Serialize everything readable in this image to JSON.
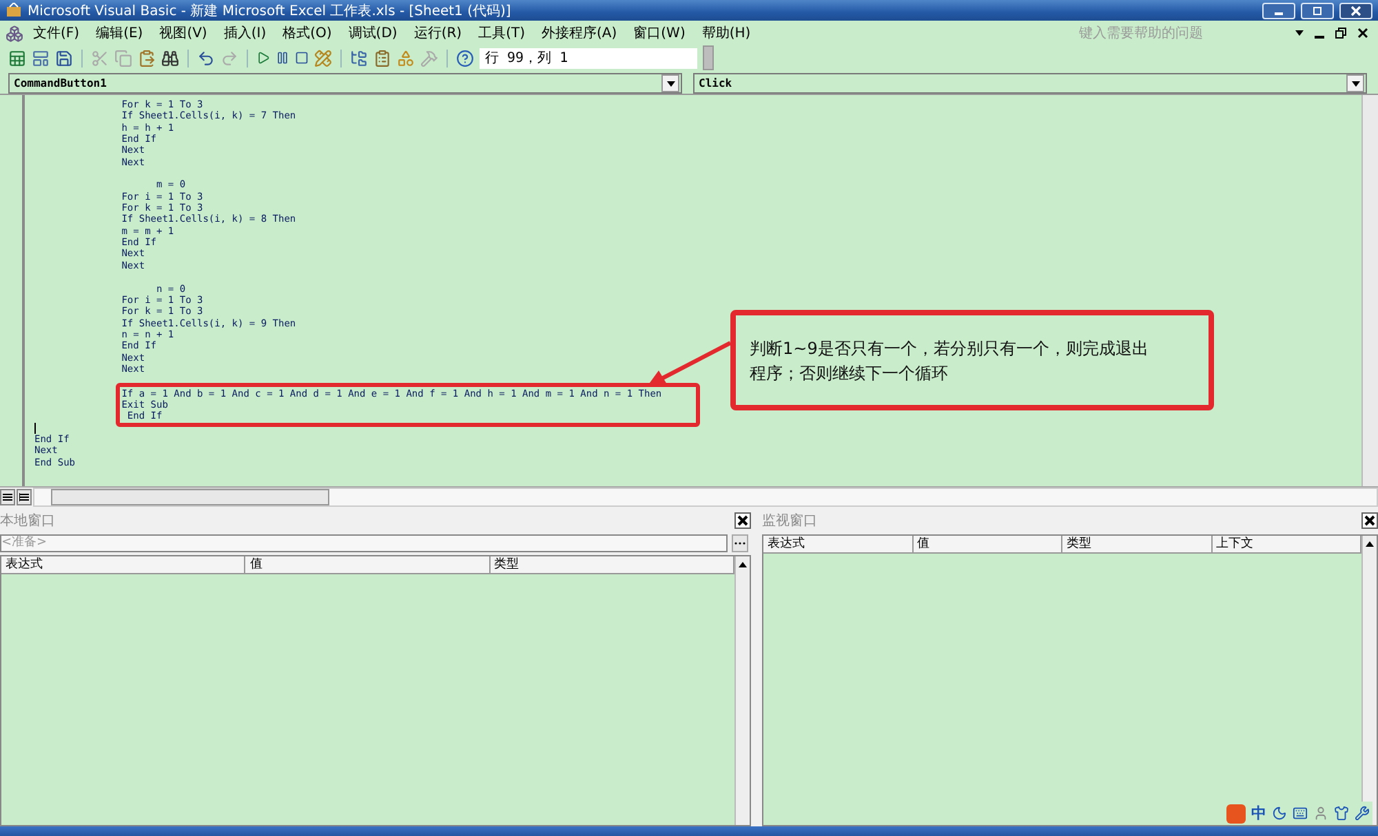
{
  "window": {
    "title": "Microsoft Visual Basic - 新建 Microsoft Excel 工作表.xls - [Sheet1 (代码)]"
  },
  "menu": [
    "文件(F)",
    "编辑(E)",
    "视图(V)",
    "插入(I)",
    "格式(O)",
    "调试(D)",
    "运行(R)",
    "工具(T)",
    "外接程序(A)",
    "窗口(W)",
    "帮助(H)"
  ],
  "help_search": {
    "placeholder": "键入需要帮助的问题"
  },
  "toolbar": {
    "position": "行 99，列 1"
  },
  "code_window": {
    "object": "CommandButton1",
    "procedure": "Click",
    "lines": [
      {
        "kind": "code",
        "text": "               For k = 1 To 3"
      },
      {
        "kind": "code",
        "text": "               If Sheet1.Cells(i, k) = 7 Then"
      },
      {
        "kind": "code",
        "text": "               h = h + 1"
      },
      {
        "kind": "code",
        "text": "               End If"
      },
      {
        "kind": "code",
        "text": "               Next"
      },
      {
        "kind": "code",
        "text": "               Next"
      },
      {
        "kind": "blank"
      },
      {
        "kind": "code",
        "text": "                     m = 0"
      },
      {
        "kind": "code",
        "text": "               For i = 1 To 3"
      },
      {
        "kind": "code",
        "text": "               For k = 1 To 3"
      },
      {
        "kind": "code",
        "text": "               If Sheet1.Cells(i, k) = 8 Then"
      },
      {
        "kind": "code",
        "text": "               m = m + 1"
      },
      {
        "kind": "code",
        "text": "               End If"
      },
      {
        "kind": "code",
        "text": "               Next"
      },
      {
        "kind": "code",
        "text": "               Next"
      },
      {
        "kind": "blank"
      },
      {
        "kind": "code",
        "text": "                     n = 0"
      },
      {
        "kind": "code",
        "text": "               For i = 1 To 3"
      },
      {
        "kind": "code",
        "text": "               For k = 1 To 3"
      },
      {
        "kind": "code",
        "text": "               If Sheet1.Cells(i, k) = 9 Then"
      },
      {
        "kind": "code",
        "text": "               n = n + 1"
      },
      {
        "kind": "code",
        "text": "               End If"
      },
      {
        "kind": "code",
        "text": "               Next"
      },
      {
        "kind": "code",
        "text": "               Next"
      },
      {
        "kind": "blank"
      },
      {
        "kind": "highlight",
        "lines": [
          {
            "kind": "code",
            "text": "               If a = 1 And b = 1 And c = 1 And d = 1 And e = 1 And f = 1 And h = 1 And m = 1 And n = 1 Then"
          },
          {
            "kind": "code",
            "text": "               Exit Sub"
          },
          {
            "kind": "code",
            "text": "                End If"
          }
        ]
      },
      {
        "kind": "cursor"
      },
      {
        "kind": "code",
        "text": "End If"
      },
      {
        "kind": "code",
        "text": "Next"
      },
      {
        "kind": "code",
        "text": "End Sub"
      }
    ]
  },
  "callout": {
    "text": "判断1~9是否只有一个，若分别只有一个，则完成退出程序；否则继续下一个循环"
  },
  "locals_window": {
    "title": "本地窗口",
    "context": "<准备>",
    "columns": [
      "表达式",
      "值",
      "类型"
    ]
  },
  "watch_window": {
    "title": "监视窗口",
    "columns": [
      "表达式",
      "值",
      "类型",
      "上下文"
    ]
  },
  "ime_bar": {
    "mode": "中"
  }
}
